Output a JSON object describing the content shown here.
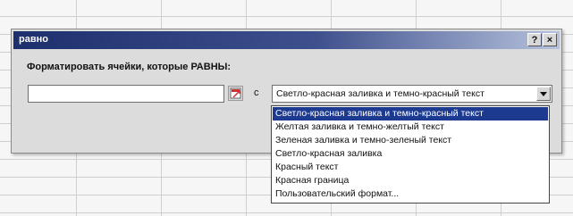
{
  "dialog": {
    "title": "равно",
    "help_label": "?",
    "close_label": "×",
    "prompt": "Форматировать ячейки, которые РАВНЫ:",
    "value_input": {
      "value": "",
      "placeholder": ""
    },
    "with_label": "с",
    "format_select": {
      "selected": "Светло-красная заливка и темно-красный текст"
    }
  },
  "dropdown": {
    "items": [
      "Светло-красная заливка и темно-красный текст",
      "Желтая заливка и темно-желтый текст",
      "Зеленая заливка и темно-зеленый текст",
      "Светло-красная заливка",
      "Красный текст",
      "Красная граница",
      "Пользовательский формат..."
    ],
    "highlighted_index": 0
  },
  "colors": {
    "title_bar_start": "#1e2f6d",
    "title_bar_end": "#b6c2dd",
    "selection": "#1c3a8f",
    "dialog_bg": "#dcdcdc"
  },
  "icons": {
    "ref_button": "range-select-icon",
    "dropdown": "chevron-down-icon"
  }
}
